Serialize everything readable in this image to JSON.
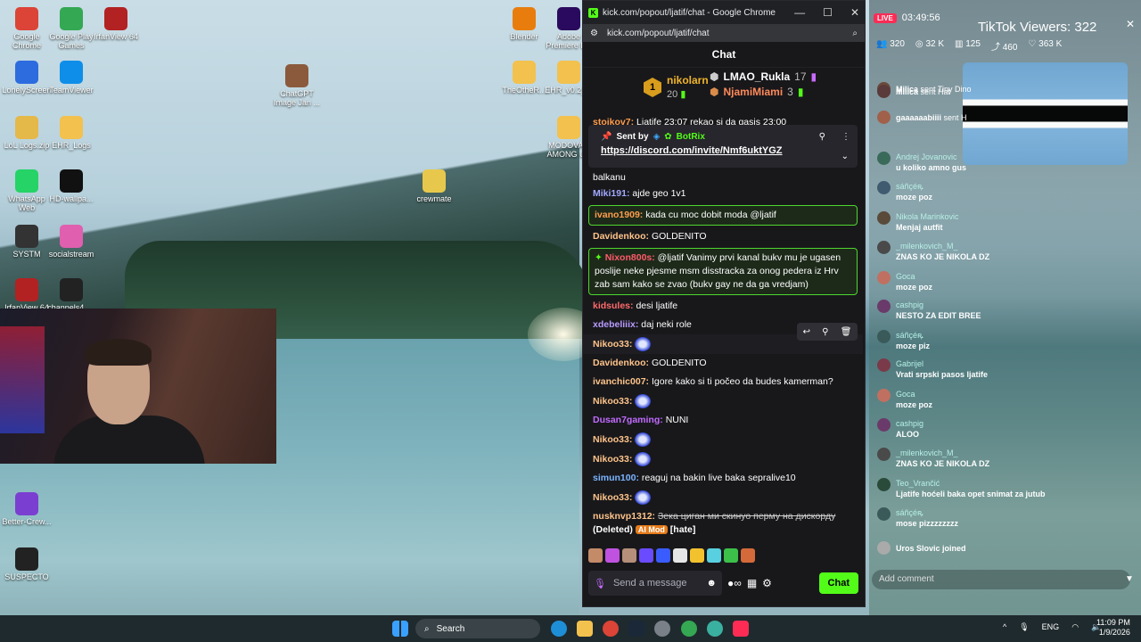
{
  "desktop": {
    "icons": [
      {
        "label": "Google Chrome",
        "color": "#db4437"
      },
      {
        "label": "Google Play Games",
        "color": "#34a853"
      },
      {
        "label": "IrfanView 64",
        "color": "#b22222"
      },
      {
        "label": "LonelyScreen",
        "color": "#2d6cdf"
      },
      {
        "label": "TeamViewer",
        "color": "#0e8ee9"
      },
      {
        "label": "LoL Logs.zip",
        "color": "#e5b84a"
      },
      {
        "label": "EHR_Logs",
        "color": "#f2c14e"
      },
      {
        "label": "WhatsApp Web",
        "color": "#25d366"
      },
      {
        "label": "HD-wallpa...",
        "color": "#111"
      },
      {
        "label": "SYSTM",
        "color": "#333"
      },
      {
        "label": "socialstream",
        "color": "#e05fae"
      },
      {
        "label": "IrfanView 64",
        "color": "#b22222"
      },
      {
        "label": "channels4_...",
        "color": "#222"
      },
      {
        "label": "Better-Crew...",
        "color": "#7a3fd0"
      },
      {
        "label": "SUSPECTO",
        "color": "#222"
      },
      {
        "label": "ChatGPT Image Jan ...",
        "color": "#8b5a3c"
      },
      {
        "label": "Blender",
        "color": "#e87d0d"
      },
      {
        "label": "Adobe Premiere P...",
        "color": "#2a0a5e"
      },
      {
        "label": "TheOtheR...",
        "color": "#f2c14e"
      },
      {
        "label": "EHR_v0.2_...",
        "color": "#f2c14e"
      },
      {
        "label": "MODOVAN AMONG US",
        "color": "#f2c14e"
      },
      {
        "label": "crewmate",
        "color": "#e8c84c"
      }
    ]
  },
  "browser": {
    "window_title": "kick.com/popout/ljatif/chat - Google Chrome",
    "url": "kick.com/popout/ljatif/chat",
    "minimize": "—",
    "maximize": "☐",
    "close": "✕",
    "zoom_icon": "zoom-icon"
  },
  "chat": {
    "header": "Chat",
    "leaderboard": {
      "rank1_badge": "1",
      "first": {
        "name": "nikolarn",
        "value": "20"
      },
      "second": {
        "name": "LMAO_Rukla",
        "value": "17"
      },
      "third": {
        "name": "NjamiMiami",
        "value": "3"
      }
    },
    "pinned": {
      "sent_by": "Sent by",
      "sender": "BotRix",
      "link": "https://discord.com/invite/Nmf6uktYGZ"
    },
    "partial_top": {
      "user": "stoikov7:",
      "text": "Ljatife 23:07 rekao si da gasis 23:00"
    },
    "partial_after_pin": "balkanu",
    "messages": [
      {
        "user": "Miki191:",
        "color": "#a1a8ff",
        "text": "ajde geo 1v1",
        "hl": false
      },
      {
        "user": "ivano1909:",
        "color": "#ff9d4d",
        "text": "kada cu moc dobit moda @ljatif",
        "hl": true
      },
      {
        "user": "Davidenkoo:",
        "color": "#ffc48a",
        "text": "GOLDENITO",
        "hl": false
      },
      {
        "user": "Nixon800s:",
        "color": "#ff5a6a",
        "text": "@ljatif Vanimy prvi kanal bukv mu je ugasen poslije neke pjesme msm disstracka za onog pedera iz Hrv zab sam kako se zvao (bukv gay ne da ga vredjam)",
        "hl": true
      },
      {
        "user": "kidsules:",
        "color": "#ff6a6a",
        "text": "desi ljatife",
        "hl": false
      },
      {
        "user": "xdebeliiix:",
        "color": "#b89bff",
        "text": "daj neki role",
        "hl": false
      },
      {
        "user": "Nikoo33:",
        "color": "#ffc48a",
        "text": "",
        "emote": true,
        "hl": false
      },
      {
        "user": "Davidenkoo:",
        "color": "#ffc48a",
        "text": "GOLDENITO",
        "hl": false
      },
      {
        "user": "ivanchic007:",
        "color": "#ffc48a",
        "text": "Igore kako si ti počeo da budes kamerman?",
        "hl": false
      },
      {
        "user": "Nikoo33:",
        "color": "#ffc48a",
        "text": "",
        "emote": true,
        "hl": false
      },
      {
        "user": "Dusan7gaming:",
        "color": "#c26bff",
        "text": "NUNI",
        "hl": false
      },
      {
        "user": "Nikoo33:",
        "color": "#ffc48a",
        "text": "",
        "emote": true,
        "hl": false
      },
      {
        "user": "Nikoo33:",
        "color": "#ffc48a",
        "text": "",
        "emote": true,
        "hl": false
      },
      {
        "user": "simun100:",
        "color": "#7ab4ff",
        "text": "reaguj na bakin live baka sepralive10",
        "hl": false
      },
      {
        "user": "Nikoo33:",
        "color": "#ffc48a",
        "text": "",
        "emote": true,
        "hl": false
      }
    ],
    "deleted": {
      "user": "nusknvp1312:",
      "text": "Зека циган ми скинуо перму на дискорду",
      "deleted_label": "(Deleted)",
      "tag": "AI Mod",
      "reason": "[hate]"
    },
    "input_placeholder": "Send a message",
    "send_label": "Chat"
  },
  "tiktok": {
    "live": "LIVE",
    "timer": "03:49:56",
    "viewers_label": "TikTok Viewers: 322",
    "stats": [
      "320",
      "32 K",
      "125",
      "460",
      "363 K"
    ],
    "messages": [
      {
        "name": "Milica",
        "text": "sent Tiny Dino"
      },
      {
        "name": "Milica",
        "text": "sent Hat"
      },
      {
        "name": "gaaaaaabiiii",
        "text": "sent H"
      },
      {
        "name": "Andrej Jovanovic",
        "text": "u koliko amno gus"
      },
      {
        "name": "sáñçéꝶ",
        "text": "moze poz"
      },
      {
        "name": "Nikola Marinkovic",
        "text": "Menjaj autfit"
      },
      {
        "name": "_milenkovich_M_",
        "text": "ZNAS KO JE NIKOLA DZ"
      },
      {
        "name": "Goca",
        "text": "moze poz"
      },
      {
        "name": "cashpig",
        "text": "NESTO ZA EDIT BREE"
      },
      {
        "name": "sáñçéꝶ",
        "text": "moze piz"
      },
      {
        "name": "Gabrijel",
        "text": "Vrati srpski pasos ljatife"
      },
      {
        "name": "Goca",
        "text": "moze poz"
      },
      {
        "name": "cashpig",
        "text": "ALOO"
      },
      {
        "name": "_milenkovich_M_",
        "text": "ZNAS KO JE NIKOLA DZ"
      },
      {
        "name": "Teo_Vrančić",
        "text": "Ljatife hoćeli baka opet snimat za jutub"
      },
      {
        "name": "sáñçéꝶ",
        "text": "mose pizzzzzzzz"
      },
      {
        "name": "",
        "text": "Uros Slovic joined"
      }
    ],
    "add_comment": "Add comment"
  },
  "taskbar": {
    "search": "Search",
    "lang": "ENG",
    "time": "11:09 PM",
    "date": "1/9/2026"
  }
}
